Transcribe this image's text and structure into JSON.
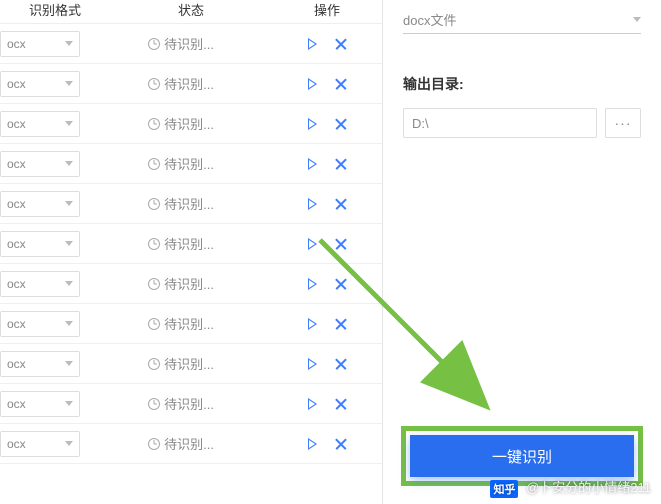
{
  "headers": {
    "format": "识别格式",
    "status": "状态",
    "ops": "操作"
  },
  "row_format": "ocx",
  "row_status": "待识别...",
  "row_count": 11,
  "right": {
    "file_type": "docx文件",
    "output_label": "输出目录:",
    "output_path": "D:\\",
    "browse": "···"
  },
  "primary_button": "一键识别",
  "watermark": "卜安分的小情绪211",
  "zhihu": "知乎"
}
